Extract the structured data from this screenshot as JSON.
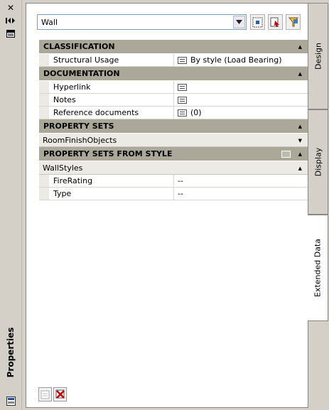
{
  "palette": {
    "title": "Properties"
  },
  "toolbar": {
    "object_type": "Wall"
  },
  "categories": [
    {
      "label": "CLASSIFICATION",
      "rows": [
        {
          "name": "Structural Usage",
          "value": "By style (Load Bearing)",
          "icon": "detail-icon"
        }
      ]
    },
    {
      "label": "DOCUMENTATION",
      "rows": [
        {
          "name": "Hyperlink",
          "value": "",
          "icon": "detail-icon"
        },
        {
          "name": "Notes",
          "value": "",
          "icon": "detail-icon"
        },
        {
          "name": "Reference documents",
          "value": "(0)",
          "icon": "detail-icon"
        }
      ]
    },
    {
      "label": "PROPERTY SETS",
      "subheader": "RoomFinishObjects"
    },
    {
      "label": "PROPERTY SETS FROM STYLE",
      "subheader": "WallStyles",
      "rows": [
        {
          "name": "FireRating",
          "value": "--"
        },
        {
          "name": "Type",
          "value": "--"
        }
      ]
    }
  ],
  "tabs": [
    {
      "label": "Design"
    },
    {
      "label": "Display"
    },
    {
      "label": "Extended Data"
    }
  ],
  "colors": {
    "category_header": "#aca899",
    "panel_background": "#d4d0c8"
  }
}
